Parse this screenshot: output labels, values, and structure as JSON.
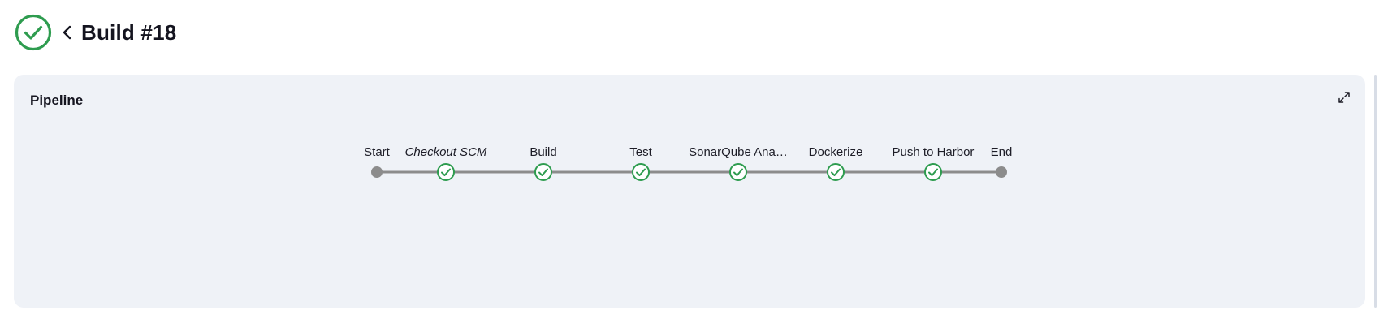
{
  "header": {
    "status": "success",
    "status_icon": "check-circle-icon",
    "back_icon": "chevron-left-icon",
    "title": "Build #18"
  },
  "panel": {
    "title": "Pipeline",
    "expand_icon": "expand-icon"
  },
  "pipeline": {
    "stages": [
      {
        "name": "Start",
        "kind": "terminal",
        "italic": false
      },
      {
        "name": "Checkout SCM",
        "kind": "success",
        "italic": true
      },
      {
        "name": "Build",
        "kind": "success",
        "italic": false
      },
      {
        "name": "Test",
        "kind": "success",
        "italic": false
      },
      {
        "name": "SonarQube Ana…",
        "kind": "success",
        "italic": false
      },
      {
        "name": "Dockerize",
        "kind": "success",
        "italic": false
      },
      {
        "name": "Push to Harbor",
        "kind": "success",
        "italic": false
      },
      {
        "name": "End",
        "kind": "terminal",
        "italic": false
      }
    ]
  },
  "colors": {
    "success": "#2e9c4f",
    "connector": "#8c8c8c",
    "terminal": "#8c8c8c",
    "panel_bg": "#eff2f7"
  }
}
